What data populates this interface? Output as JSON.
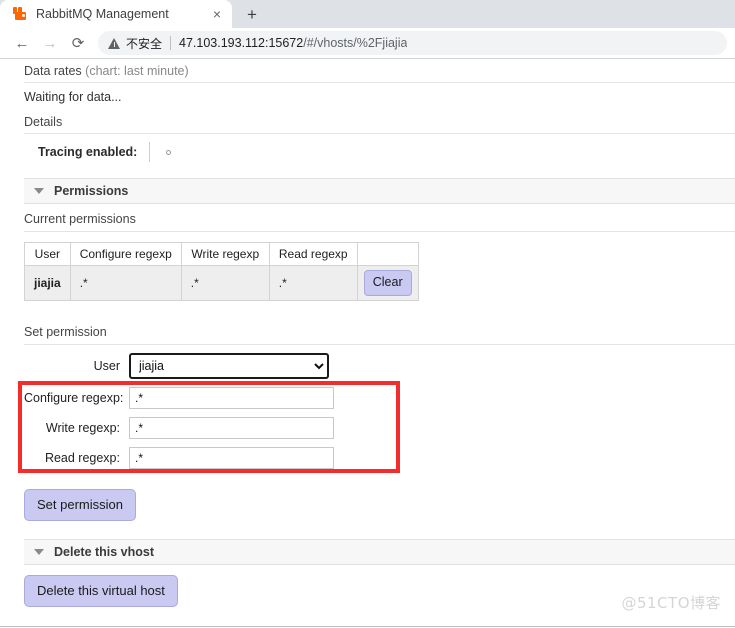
{
  "browser": {
    "tab": {
      "title": "RabbitMQ Management",
      "favicon": "rabbitmq-favicon",
      "close_label": "×"
    },
    "new_tab_label": "+",
    "nav": {
      "back_label": "←",
      "forward_label": "→",
      "reload_label": "⟳"
    },
    "omnibox": {
      "security_label": "不安全",
      "url_host": "47.103.193.112:15672",
      "url_path": "/#/vhosts/%2Fjiajia"
    }
  },
  "page": {
    "data_rates": {
      "title": "Data rates",
      "subtitle": "(chart: last minute)",
      "status": "Waiting for data..."
    },
    "details": {
      "title": "Details",
      "tracing_label": "Tracing enabled:",
      "tracing_value": ""
    },
    "permissions": {
      "section_title": "Permissions",
      "current_title": "Current permissions",
      "table": {
        "headers": [
          "User",
          "Configure regexp",
          "Write regexp",
          "Read regexp",
          ""
        ],
        "rows": [
          {
            "user": "jiajia",
            "configure": ".*",
            "write": ".*",
            "read": ".*",
            "action_label": "Clear"
          }
        ]
      },
      "set_permission": {
        "title": "Set permission",
        "user_label": "User",
        "user_value": "jiajia",
        "user_options": [
          "jiajia"
        ],
        "configure_label": "Configure regexp:",
        "configure_value": ".*",
        "write_label": "Write regexp:",
        "write_value": ".*",
        "read_label": "Read regexp:",
        "read_value": ".*",
        "submit_label": "Set permission"
      }
    },
    "delete_vhost": {
      "section_title": "Delete this vhost",
      "button_label": "Delete this virtual host"
    },
    "watermark": "@51CTO博客",
    "annotation": {
      "color": "#f42c2c"
    }
  }
}
